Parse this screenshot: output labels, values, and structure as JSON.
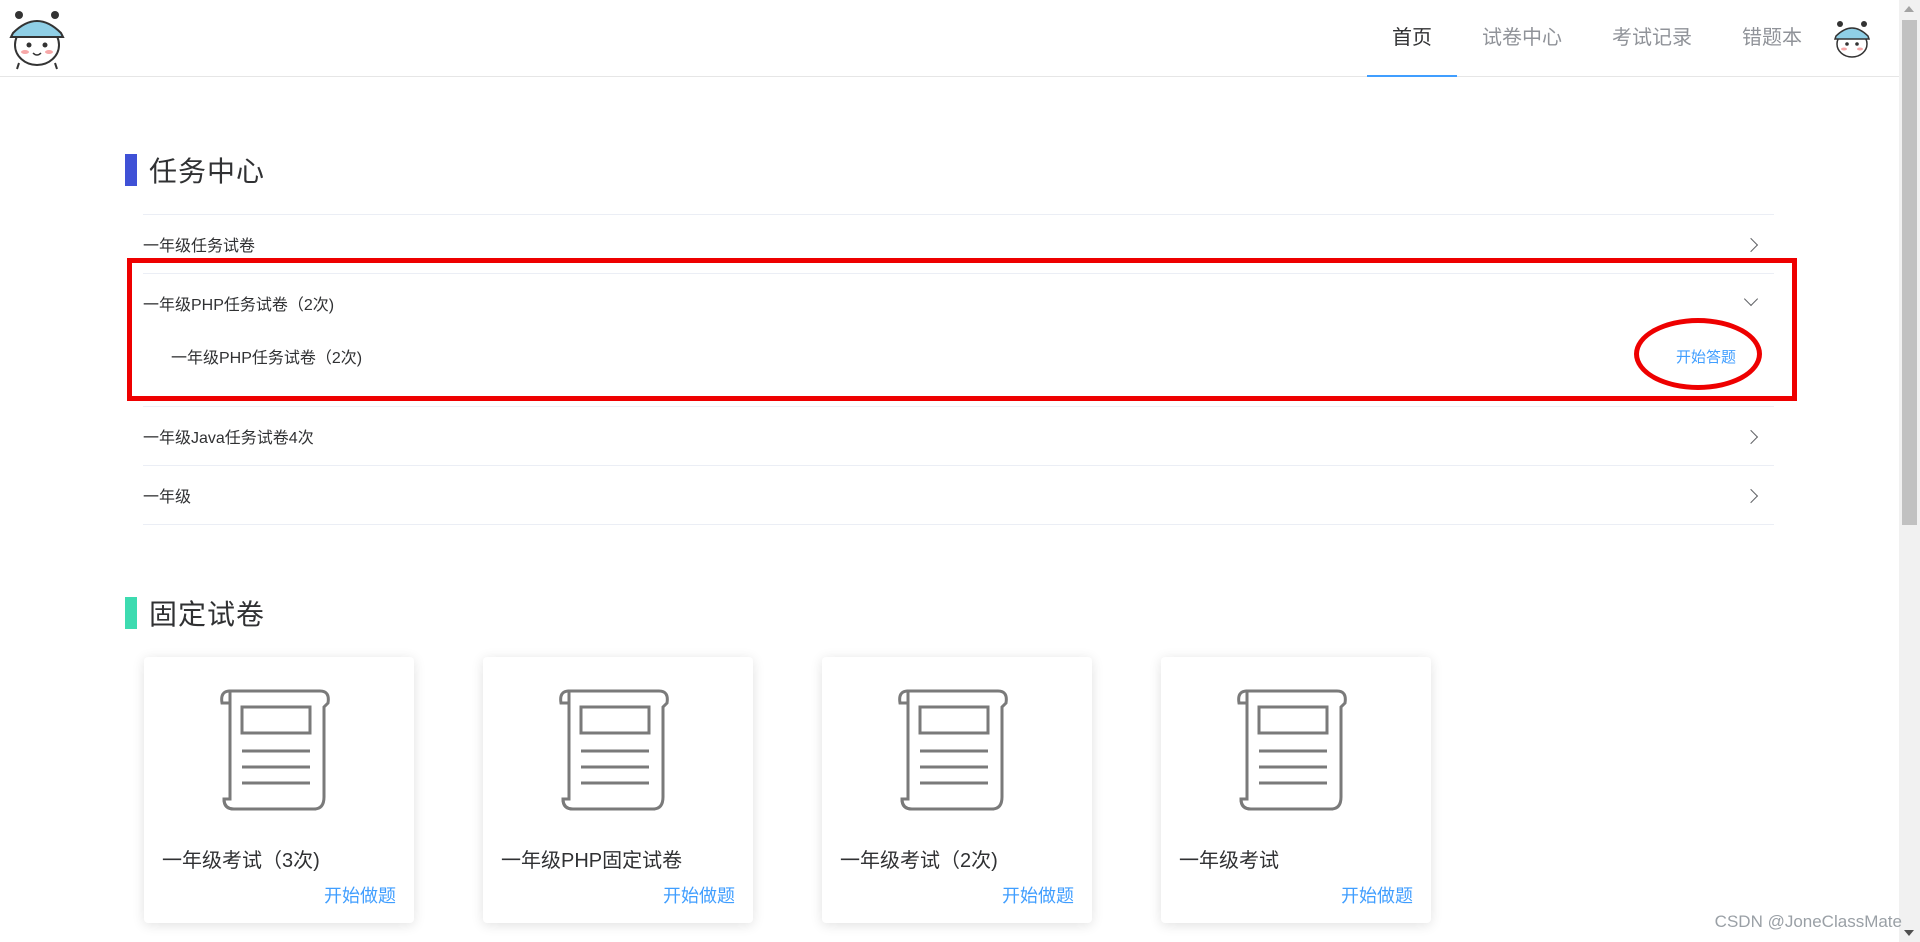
{
  "header": {
    "nav": [
      "首页",
      "试卷中心",
      "考试记录",
      "错题本"
    ]
  },
  "task_center": {
    "title": "任务中心",
    "accent_color": "#3f51d6",
    "items": [
      {
        "label": "一年级任务试卷",
        "expanded": false
      },
      {
        "label": "一年级PHP任务试卷（2次)",
        "expanded": true,
        "sub_label": "一年级PHP任务试卷（2次)",
        "action": "开始答题"
      },
      {
        "label": "一年级Java任务试卷4次",
        "expanded": false
      },
      {
        "label": "一年级",
        "expanded": false
      }
    ]
  },
  "fixed_papers": {
    "title": "固定试卷",
    "accent_color": "#3ddbb0",
    "cards": [
      {
        "title": "一年级考试（3次)",
        "action": "开始做题"
      },
      {
        "title": "一年级PHP固定试卷",
        "action": "开始做题"
      },
      {
        "title": "一年级考试（2次)",
        "action": "开始做题"
      },
      {
        "title": "一年级考试",
        "action": "开始做题"
      }
    ]
  },
  "icons": {
    "logo": "cartoon-avatar-icon",
    "avatar": "user-avatar-icon",
    "card_icon": "scroll-document-icon",
    "collapse_arrow": "chevron-right-icon"
  },
  "colors": {
    "link": "#409eff",
    "highlight": "#ee0000"
  },
  "watermark": "CSDN @JoneClassMate"
}
